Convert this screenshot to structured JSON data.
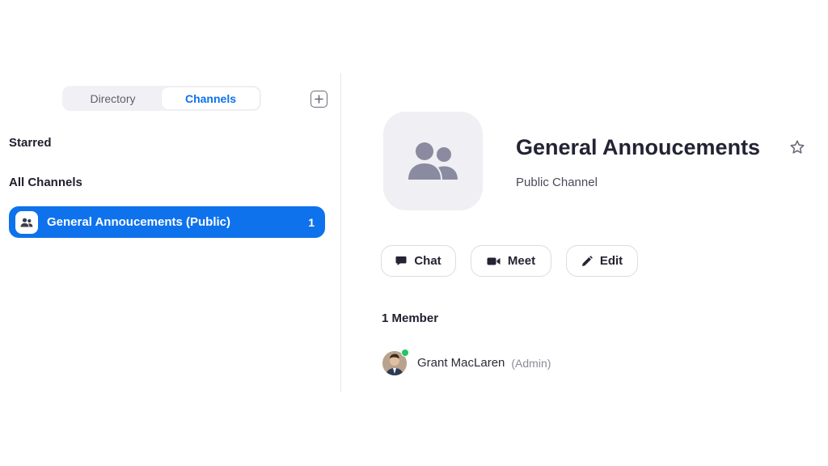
{
  "tabs": {
    "directory": "Directory",
    "channels": "Channels",
    "active": "channels"
  },
  "sidebar": {
    "starred_label": "Starred",
    "all_channels_label": "All Channels",
    "channels": [
      {
        "name": "General Annoucements (Public)",
        "unread": "1",
        "selected": true
      }
    ]
  },
  "channel": {
    "title": "General Annoucements",
    "type": "Public Channel",
    "actions": {
      "chat": "Chat",
      "meet": "Meet",
      "edit": "Edit"
    }
  },
  "members": {
    "count_label": "1 Member",
    "list": [
      {
        "name": "Grant MacLaren",
        "role": "(Admin)",
        "status": "online"
      }
    ]
  },
  "icons": {
    "add": "plus-square-icon",
    "channel": "group-icon",
    "star": "star-outline-icon",
    "chat": "chat-bubble-icon",
    "meet": "video-camera-icon",
    "edit": "pencil-icon"
  },
  "colors": {
    "accent": "#0e72ed",
    "online": "#22c55e",
    "avatar_bg": "#efeff4"
  }
}
